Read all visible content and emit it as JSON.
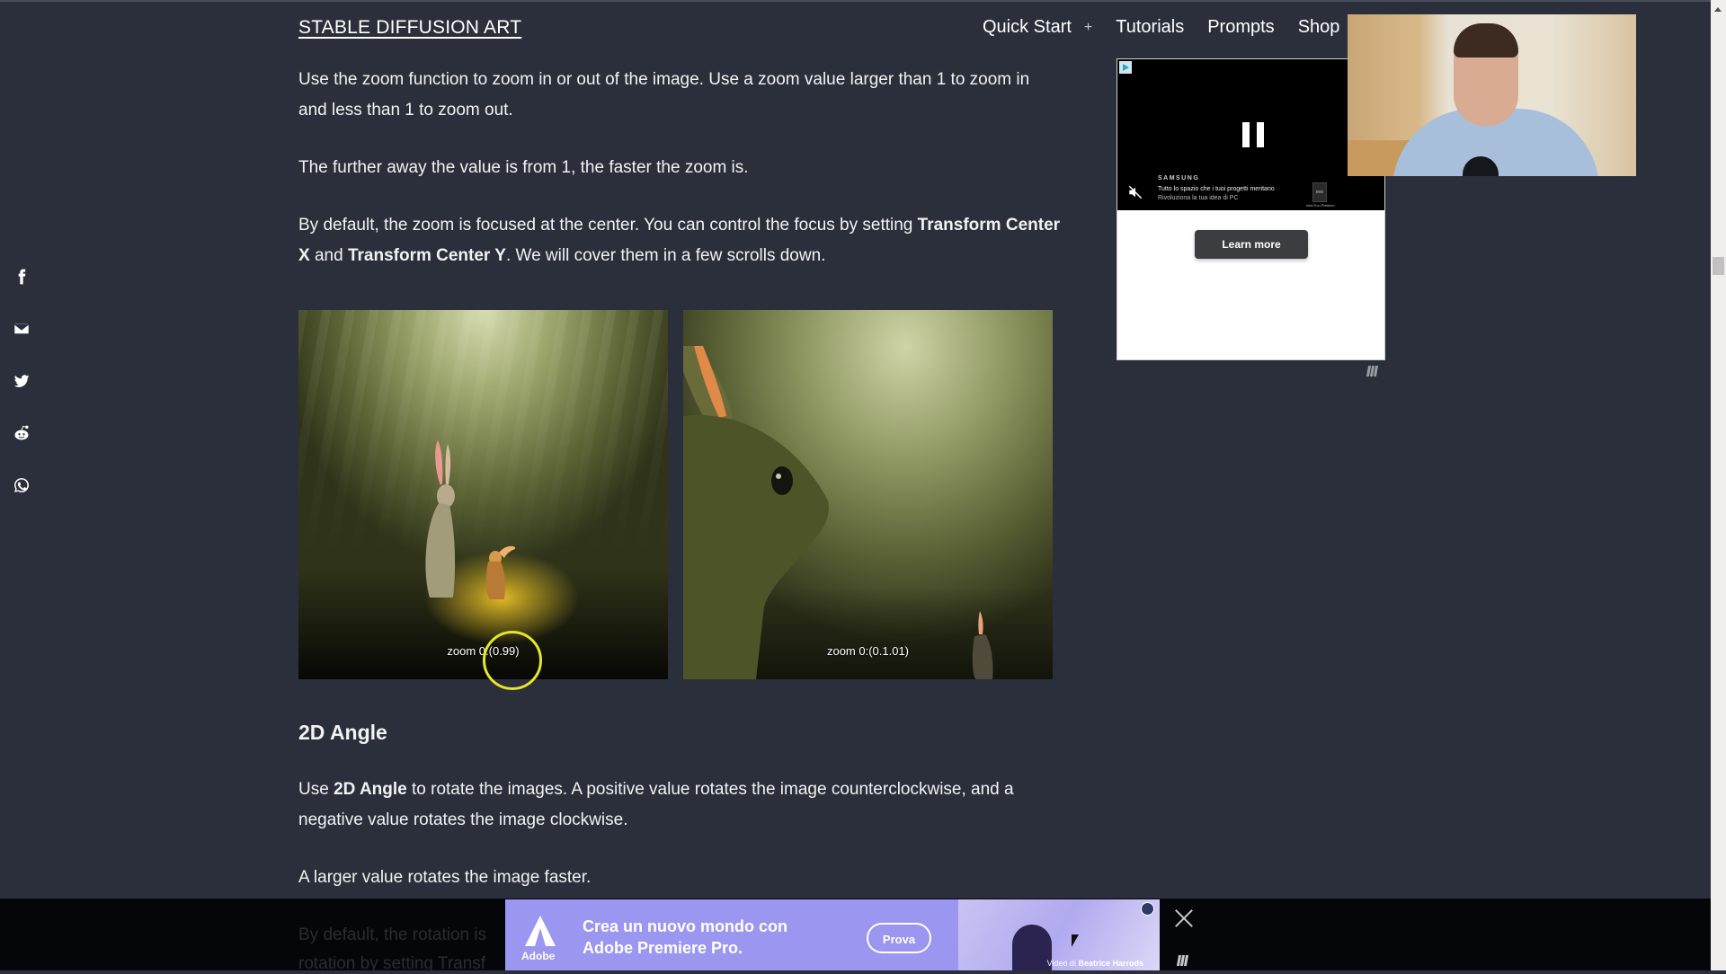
{
  "header": {
    "site_title": "STABLE DIFFUSION ART",
    "nav": [
      {
        "label": "Quick Start"
      },
      {
        "label": "+"
      },
      {
        "label": "Tutorials"
      },
      {
        "label": "Prompts"
      },
      {
        "label": "Shop"
      }
    ]
  },
  "share_bar": {
    "icons": [
      "facebook-icon",
      "email-icon",
      "twitter-icon",
      "reddit-icon",
      "whatsapp-icon"
    ]
  },
  "article": {
    "p1": "Use the zoom function to zoom in or out of the image. Use a zoom value larger than 1 to zoom in and less than 1 to zoom out.",
    "p2": "The further away the value is from 1, the faster the zoom is.",
    "p3_before": "By default, the zoom is focused at the center. You can control the focus by setting ",
    "p3_bold1": "Transform Center X",
    "p3_mid": " and ",
    "p3_bold2": "Transform Center Y",
    "p3_after": ". We will cover them in a few scrolls down.",
    "images": [
      {
        "caption": "zoom 0:(0.99)"
      },
      {
        "caption": "zoom 0:(0.1.01)"
      }
    ],
    "heading": "2D Angle",
    "p4_before": "Use ",
    "p4_bold": "2D Angle",
    "p4_after": " to rotate the images. A positive value rotates the image counterclockwise, and a negative value rotates the image clockwise.",
    "p5": "A larger value rotates the image faster.",
    "faded_line1": "By default, the rotation is",
    "faded_line2": "rotation by setting Transf"
  },
  "side_ad": {
    "brand": "SAMSUNG",
    "line1": "Tutto lo spazio che i tuoi progetti meritano",
    "line2": "Rivoluziona la tua idea di PC",
    "badge": "evo",
    "badge_caption": "Intel Evo Platform",
    "cta": "Learn more"
  },
  "bottom_ad": {
    "brand": "Adobe",
    "text_line1": "Crea un nuovo mondo con",
    "text_line2": "Adobe Premiere Pro.",
    "cta": "Prova",
    "credit_prefix": "Video di ",
    "credit_name": "Beatrice Harrods"
  },
  "colors": {
    "background": "#2b2f3b",
    "text": "#f2f2f2",
    "adobe_purple": "#9b96f0",
    "cursor_highlight": "#e6e62a"
  }
}
